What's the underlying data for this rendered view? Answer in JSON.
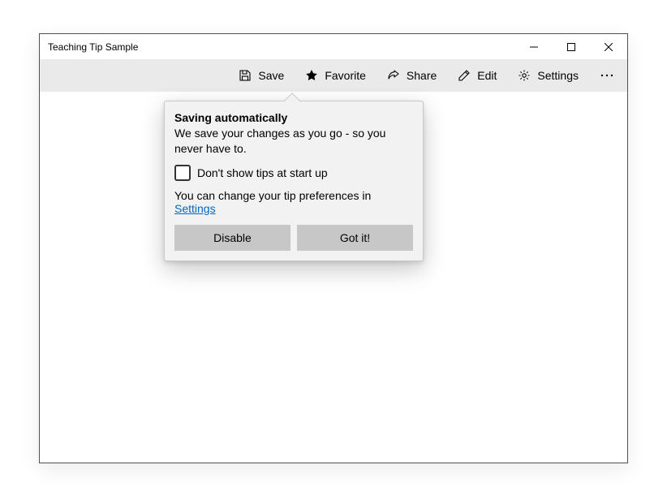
{
  "window": {
    "title": "Teaching Tip Sample"
  },
  "toolbar": {
    "save": "Save",
    "favorite": "Favorite",
    "share": "Share",
    "edit": "Edit",
    "settings": "Settings"
  },
  "tip": {
    "title": "Saving automatically",
    "subtitle": "We save your changes as you go - so you never have to.",
    "checkbox_label": "Don't show tips at start up",
    "footer_prefix": "You can change your tip preferences in ",
    "footer_link": "Settings",
    "action_button": "Disable",
    "close_button": "Got it!"
  }
}
